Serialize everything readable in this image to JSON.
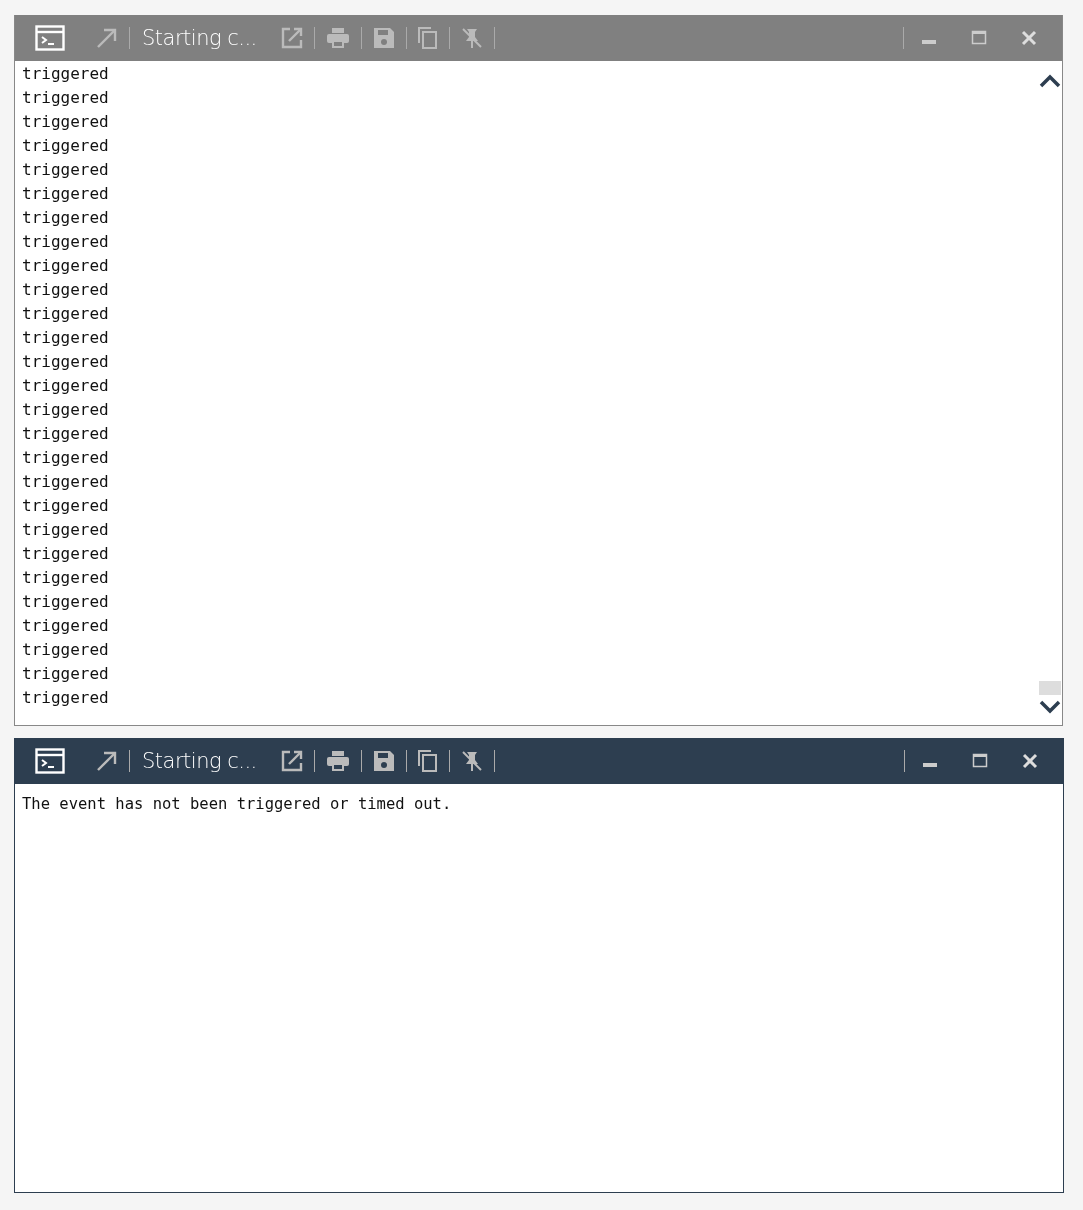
{
  "windows": [
    {
      "title": "Starting c...",
      "active": false,
      "scrollable": true,
      "lines": [
        "triggered",
        "triggered",
        "triggered",
        "triggered",
        "triggered",
        "triggered",
        "triggered",
        "triggered",
        "triggered",
        "triggered",
        "triggered",
        "triggered",
        "triggered",
        "triggered",
        "triggered",
        "triggered",
        "triggered",
        "triggered",
        "triggered",
        "triggered",
        "triggered",
        "triggered",
        "triggered",
        "triggered",
        "triggered",
        "triggered",
        "triggered"
      ]
    },
    {
      "title": "Starting c...",
      "active": true,
      "scrollable": false,
      "lines": [
        "The event has not been triggered or timed out."
      ]
    }
  ]
}
